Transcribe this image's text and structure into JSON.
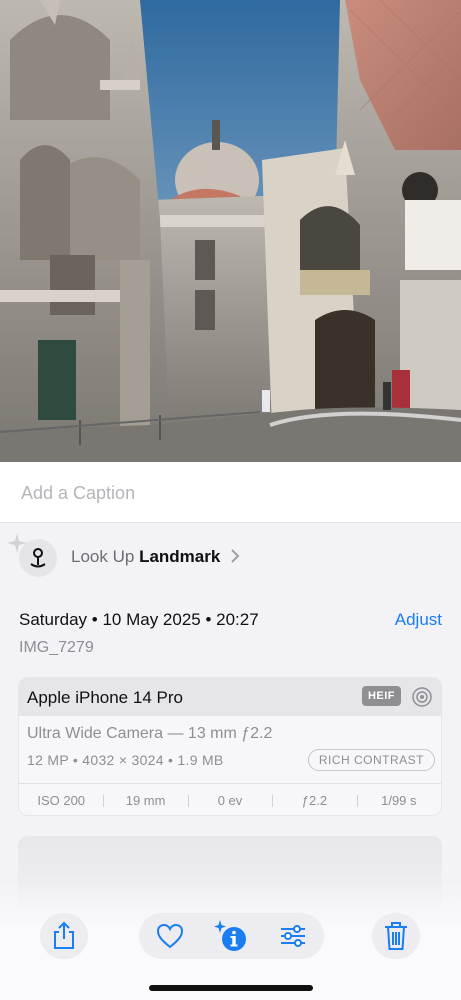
{
  "photo": {
    "subject": "Venice landmark photo"
  },
  "caption": {
    "placeholder": "Add a Caption"
  },
  "lookup": {
    "prefix": "Look Up",
    "subject": "Landmark"
  },
  "info": {
    "date": "Saturday • 10 May 2025 • 20:27",
    "adjust_label": "Adjust",
    "filename": "IMG_7279"
  },
  "camera": {
    "device": "Apple iPhone 14 Pro",
    "format_badge": "HEIF",
    "lens": "Ultra Wide Camera — 13 mm ƒ2.2",
    "specs": "12 MP • 4032 × 3024 • 1.9 MB",
    "style_badge": "RICH CONTRAST",
    "exif": [
      "ISO 200",
      "19 mm",
      "0 ev",
      "ƒ2.2",
      "1/99 s"
    ]
  },
  "colors": {
    "accent": "#1a7ef2",
    "background": "#f2f2f7"
  }
}
